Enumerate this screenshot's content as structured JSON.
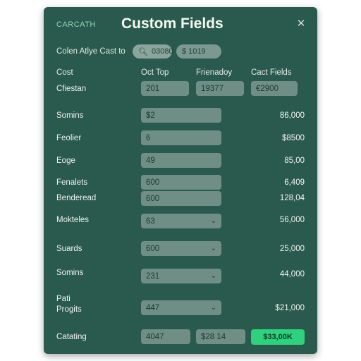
{
  "header": {
    "brand": "CARCATH",
    "title": "Custom Fields",
    "close_icon": "close-icon"
  },
  "toolbar": {
    "label": "Colen Atlye Cast to",
    "search_value": "03080",
    "price_value": "$ 1019"
  },
  "columns": [
    "Cost",
    "Oct Top",
    "Frienadoy",
    "Cact Fields"
  ],
  "summary_row": {
    "label": "Cfiestan",
    "values": [
      "201",
      "19377",
      "€2900"
    ]
  },
  "rows": [
    {
      "label": "Somins",
      "value": "$2",
      "amount": "86,000",
      "dropdown": false
    },
    {
      "label": "Feolier",
      "value": "6",
      "amount": "$8500",
      "dropdown": false
    },
    {
      "label": "Eoge",
      "value": "49",
      "amount": "85,00",
      "dropdown": false
    },
    {
      "label": "Fenalets",
      "value": "600",
      "amount": "6,409",
      "dropdown": false
    },
    {
      "label": "Benderead",
      "value": "600",
      "amount": "128,04",
      "dropdown": false
    },
    {
      "label": "Mokteles",
      "value": "63",
      "amount": "56,000",
      "dropdown": true
    },
    {
      "label": "Suards",
      "value": "600",
      "amount": "25,000",
      "dropdown": true
    },
    {
      "label": "Somins",
      "value": "231",
      "amount": "44,000",
      "dropdown": true
    },
    {
      "label": "Pati Progits",
      "label_line1": "Pati",
      "label_line2": "Progits",
      "value": "447",
      "amount": "$21,000",
      "dropdown": true
    }
  ],
  "footer": {
    "label": "Catating",
    "values": [
      "4047",
      "$28 14"
    ],
    "total_button": "$33,00K"
  },
  "colors": {
    "panel": "#2a5a4d",
    "field": "#6f8f86",
    "accent": "#2fd07e",
    "brand": "#8fd6bc"
  }
}
